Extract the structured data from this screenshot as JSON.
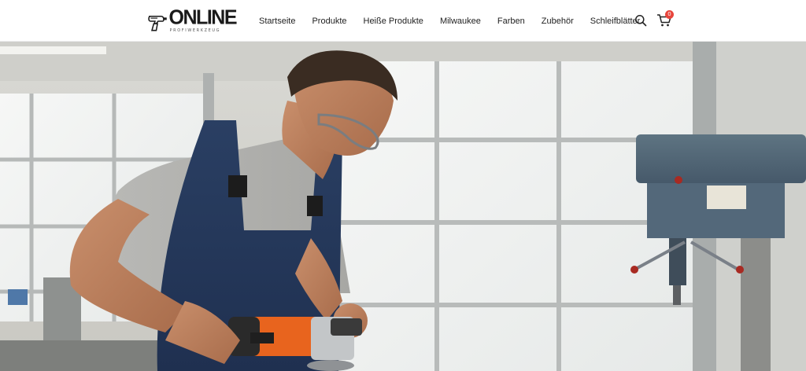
{
  "header": {
    "logo": {
      "word": "ONLINE",
      "tagline": "PROFIWERKZEUG",
      "icon": "drill-icon"
    },
    "nav": [
      {
        "label": "Startseite"
      },
      {
        "label": "Produkte"
      },
      {
        "label": "Heiße Produkte"
      },
      {
        "label": "Milwaukee"
      },
      {
        "label": "Farben"
      },
      {
        "label": "Zubehör"
      },
      {
        "label": "Schleifblätter"
      }
    ],
    "search_icon": "search-icon",
    "cart": {
      "icon": "cart-icon",
      "count": "0"
    }
  },
  "hero": {
    "image": "worker-using-angle-grinder-in-workshop"
  },
  "colors": {
    "header_bg": "#ffffff",
    "badge": "#e8453c",
    "text": "#222222",
    "grinder_orange": "#e8641e"
  }
}
